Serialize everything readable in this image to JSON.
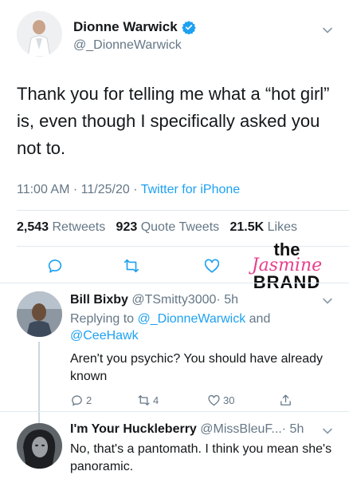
{
  "main_tweet": {
    "name": "Dionne Warwick",
    "handle": "@_DionneWarwick",
    "verified_icon": "verified-badge-icon",
    "text": "Thank you for telling me what a “hot girl” is, even though I specifically asked you not to.",
    "time": "11:00 AM",
    "date": "11/25/20",
    "dot": "·",
    "source": "Twitter for iPhone",
    "retweets_count": "2,543",
    "retweets_label": "Retweets",
    "quote_count": "923",
    "quote_label": "Quote Tweets",
    "likes_count": "21.5K",
    "likes_label": "Likes"
  },
  "watermark": {
    "line1": "the",
    "line2": "Jasmine",
    "line3": "BRAND"
  },
  "replies": [
    {
      "name": "Bill Bixby",
      "handle": "@TSmitty3000",
      "time": "· 5h",
      "replying_prefix": "Replying to",
      "mention1": "@_DionneWarwick",
      "and": "and",
      "mention2": "@CeeHawk",
      "text": "Aren't you psychic? You should have already known",
      "reply_count": "2",
      "retweet_count": "4",
      "like_count": "30"
    },
    {
      "name": "I'm Your Huckleberry",
      "handle": "@MissBleuF...",
      "time": "· 5h",
      "text": "No, that's a pantomath. I think you mean she's panoramic."
    }
  ],
  "colors": {
    "accent": "#1da1f2",
    "secondary_text": "#657786",
    "watermark_pink": "#e8408c"
  }
}
